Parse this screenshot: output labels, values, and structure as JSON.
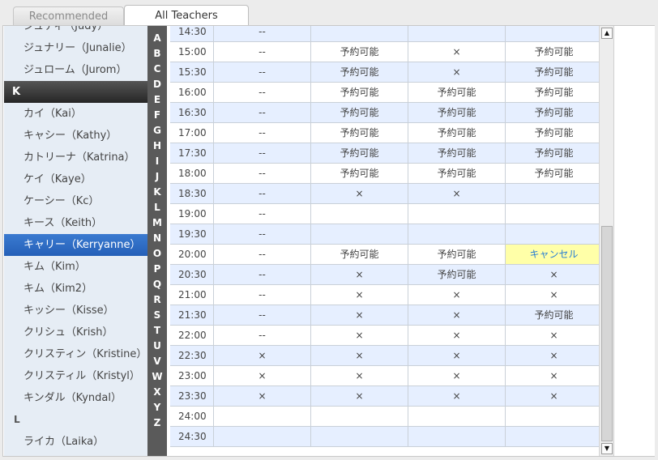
{
  "tabs": [
    {
      "label": "Recommended",
      "active": false
    },
    {
      "label": "All Teachers",
      "active": true
    }
  ],
  "teacher_list": [
    {
      "kind": "item",
      "label": "ジュディ（Judy）"
    },
    {
      "kind": "item",
      "label": "ジュナリー（Junalie）"
    },
    {
      "kind": "item",
      "label": "ジュローム（Jurom）"
    },
    {
      "kind": "letter-dark",
      "label": "K"
    },
    {
      "kind": "item",
      "label": "カイ（Kai）"
    },
    {
      "kind": "item",
      "label": "キャシー（Kathy）"
    },
    {
      "kind": "item",
      "label": "カトリーナ（Katrina）"
    },
    {
      "kind": "item",
      "label": "ケイ（Kaye）"
    },
    {
      "kind": "item",
      "label": "ケーシー（Kc）"
    },
    {
      "kind": "item",
      "label": "キース（Keith）"
    },
    {
      "kind": "item",
      "label": "キャリー（Kerryanne）",
      "selected": true
    },
    {
      "kind": "item",
      "label": "キム（Kim）"
    },
    {
      "kind": "item",
      "label": "キム（Kim2）"
    },
    {
      "kind": "item",
      "label": "キッシー（Kisse）"
    },
    {
      "kind": "item",
      "label": "クリシュ（Krish）"
    },
    {
      "kind": "item",
      "label": "クリスティン（Kristine）"
    },
    {
      "kind": "item",
      "label": "クリスティル（Kristyl）"
    },
    {
      "kind": "item",
      "label": "キンダル（Kyndal）"
    },
    {
      "kind": "letter-light",
      "label": "L"
    },
    {
      "kind": "item",
      "label": "ライカ（Laika）"
    }
  ],
  "alphabet": [
    "A",
    "B",
    "C",
    "D",
    "E",
    "F",
    "G",
    "H",
    "I",
    "J",
    "K",
    "L",
    "M",
    "N",
    "O",
    "P",
    "Q",
    "R",
    "S",
    "T",
    "U",
    "V",
    "W",
    "X",
    "Y",
    "Z"
  ],
  "schedule": [
    {
      "time": "14:30",
      "cells": [
        "--",
        "",
        "",
        ""
      ]
    },
    {
      "time": "15:00",
      "cells": [
        "--",
        "予約可能",
        "×",
        "予約可能"
      ]
    },
    {
      "time": "15:30",
      "cells": [
        "--",
        "予約可能",
        "×",
        "予約可能"
      ]
    },
    {
      "time": "16:00",
      "cells": [
        "--",
        "予約可能",
        "予約可能",
        "予約可能"
      ]
    },
    {
      "time": "16:30",
      "cells": [
        "--",
        "予約可能",
        "予約可能",
        "予約可能"
      ]
    },
    {
      "time": "17:00",
      "cells": [
        "--",
        "予約可能",
        "予約可能",
        "予約可能"
      ]
    },
    {
      "time": "17:30",
      "cells": [
        "--",
        "予約可能",
        "予約可能",
        "予約可能"
      ]
    },
    {
      "time": "18:00",
      "cells": [
        "--",
        "予約可能",
        "予約可能",
        "予約可能"
      ]
    },
    {
      "time": "18:30",
      "cells": [
        "--",
        "×",
        "×",
        ""
      ]
    },
    {
      "time": "19:00",
      "cells": [
        "--",
        "",
        "",
        ""
      ]
    },
    {
      "time": "19:30",
      "cells": [
        "--",
        "",
        "",
        ""
      ]
    },
    {
      "time": "20:00",
      "cells": [
        "--",
        "予約可能",
        "予約可能",
        "キャンセル"
      ]
    },
    {
      "time": "20:30",
      "cells": [
        "--",
        "×",
        "予約可能",
        "×"
      ]
    },
    {
      "time": "21:00",
      "cells": [
        "--",
        "×",
        "×",
        "×"
      ]
    },
    {
      "time": "21:30",
      "cells": [
        "--",
        "×",
        "×",
        "予約可能"
      ]
    },
    {
      "time": "22:00",
      "cells": [
        "--",
        "×",
        "×",
        "×"
      ]
    },
    {
      "time": "22:30",
      "cells": [
        "×",
        "×",
        "×",
        "×"
      ]
    },
    {
      "time": "23:00",
      "cells": [
        "×",
        "×",
        "×",
        "×"
      ]
    },
    {
      "time": "23:30",
      "cells": [
        "×",
        "×",
        "×",
        "×"
      ]
    },
    {
      "time": "24:00",
      "cells": [
        "",
        "",
        "",
        ""
      ]
    },
    {
      "time": "24:30",
      "cells": [
        "",
        "",
        "",
        ""
      ]
    }
  ],
  "scrollbar": {
    "up_icon": "▲",
    "down_icon": "▼"
  },
  "colors": {
    "selected": "#2d6cc4",
    "cancel_bg": "#ffffa8",
    "cancel_text": "#2a7fd4",
    "row_alt": "#e6efff"
  }
}
